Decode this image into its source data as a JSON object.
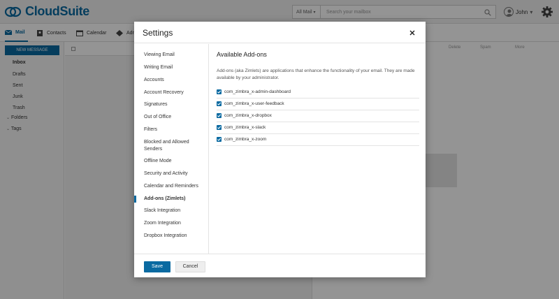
{
  "app": {
    "brand": "CloudSuite"
  },
  "search": {
    "scope": "All Mail",
    "placeholder": "Search your mailbox"
  },
  "user": {
    "name": "John"
  },
  "nav_tabs": [
    "Mail",
    "Contacts",
    "Calendar",
    "Adm"
  ],
  "sidebar": {
    "new_message": "NEW MESSAGE",
    "folders": [
      "Inbox",
      "Drafts",
      "Sent",
      "Junk",
      "Trash"
    ],
    "sections": [
      "Folders",
      "Tags"
    ]
  },
  "reading_toolbar": [
    "Delete",
    "Spam",
    "More"
  ],
  "settings": {
    "title": "Settings",
    "nav_items": [
      "Viewing Email",
      "Writing Email",
      "Accounts",
      "Account Recovery",
      "Signatures",
      "Out of Office",
      "Filters",
      "Blocked and Allowed Senders",
      "Offline Mode",
      "Security and Activity",
      "Calendar and Reminders",
      "Add-ons (Zimlets)",
      "Slack Integration",
      "Zoom Integration",
      "Dropbox Integration"
    ],
    "active_item": "Add-ons (Zimlets)",
    "section_title": "Available Add-ons",
    "description": "Add-ons (aka Zimlets) are applications that enhance the functionality of your email. They are made available by your administrator.",
    "addons": [
      {
        "name": "com_zimbra_x-admin-dashboard",
        "checked": true
      },
      {
        "name": "com_zimbra_x-user-feedback",
        "checked": true
      },
      {
        "name": "com_zimbra_x-dropbox",
        "checked": true
      },
      {
        "name": "com_zimbra_x-slack",
        "checked": true
      },
      {
        "name": "com_zimbra_x-zoom",
        "checked": true
      }
    ],
    "save_label": "Save",
    "cancel_label": "Cancel"
  },
  "colors": {
    "accent": "#0a6aa1"
  }
}
